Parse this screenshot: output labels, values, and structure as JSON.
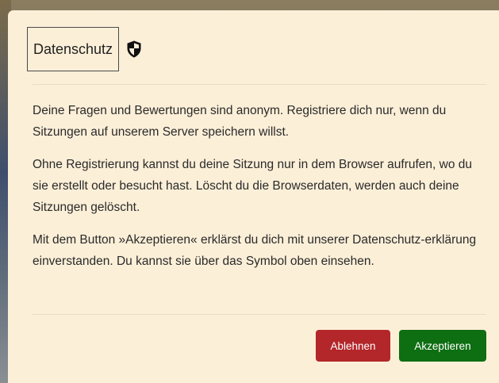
{
  "dialog": {
    "title": "Datenschutz",
    "title_icon": "shield-icon",
    "paragraphs": [
      "Deine Fragen und Bewertungen sind anonym. Registriere dich nur, wenn du Sitzungen auf unserem Server speichern willst.",
      "Ohne Registrierung kannst du deine Sitzung nur in dem Browser aufrufen, wo du sie erstellt oder besucht hast. Löscht du die Browserdaten, werden auch deine Sitzungen gelöscht.",
      "Mit dem Button »Akzeptieren« erklärst du dich mit unserer Datenschutz-erklärung einverstanden. Du kannst sie über das Symbol oben einsehen."
    ],
    "buttons": {
      "decline_label": "Ablehnen",
      "accept_label": "Akzeptieren"
    }
  },
  "colors": {
    "dialog_background": "#fcefd8",
    "decline_button": "#b3262a",
    "accept_button": "#0e6e12"
  }
}
